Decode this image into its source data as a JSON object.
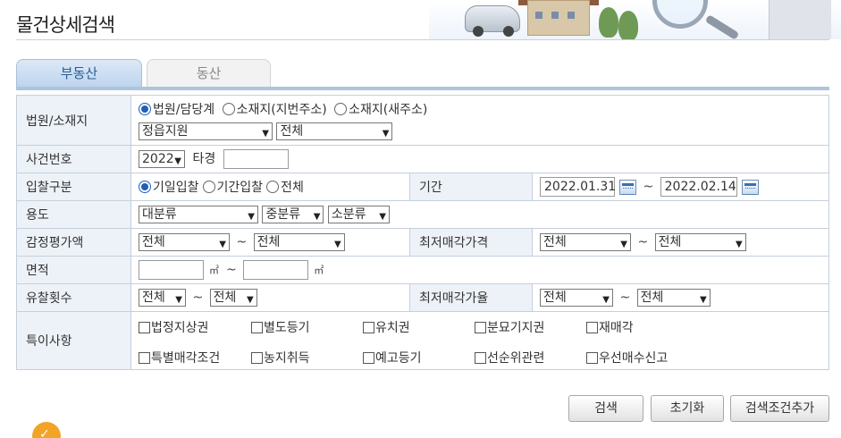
{
  "page": {
    "title": "물건상세검색"
  },
  "tabs": [
    {
      "label": "부동산",
      "active": true
    },
    {
      "label": "동산",
      "active": false
    }
  ],
  "court": {
    "label": "법원/소재지",
    "radios": [
      "법원/담당계",
      "소재지(지번주소)",
      "소재지(새주소)"
    ],
    "selected_radio": "법원/담당계",
    "court_select": "정읍지원",
    "dept_select": "전체"
  },
  "case": {
    "label": "사건번호",
    "year": "2022",
    "suffix": "타경",
    "number": ""
  },
  "bid": {
    "label": "입찰구분",
    "radios": [
      "기일입찰",
      "기간입찰",
      "전체"
    ],
    "selected_radio": "기일입찰",
    "period_label": "기간",
    "date_from": "2022.01.31",
    "date_to": "2022.02.14"
  },
  "usage": {
    "label": "용도",
    "major": "대분류",
    "medium": "중분류",
    "minor": "소분류"
  },
  "appraisal": {
    "label": "감정평가액",
    "from": "전체",
    "to": "전체",
    "min_price_label": "최저매각가격",
    "min_from": "전체",
    "min_to": "전체"
  },
  "area": {
    "label": "면적",
    "from": "",
    "to": "",
    "unit": "㎡"
  },
  "fail": {
    "label": "유찰횟수",
    "from": "전체",
    "to": "전체",
    "rate_label": "최저매각가율",
    "rate_from": "전체",
    "rate_to": "전체"
  },
  "special": {
    "label": "특이사항",
    "items": [
      "법정지상권",
      "별도등기",
      "유치권",
      "분묘기지권",
      "재매각",
      "특별매각조건",
      "농지취득",
      "예고등기",
      "선순위관련",
      "우선매수신고"
    ]
  },
  "buttons": {
    "search": "검색",
    "reset": "초기화",
    "add_condition": "검색조건추가"
  },
  "tilde": "~",
  "colors": {
    "active_tab": "#bcd3ee",
    "label_bg": "#edf2f8",
    "border": "#c5cfdb"
  }
}
